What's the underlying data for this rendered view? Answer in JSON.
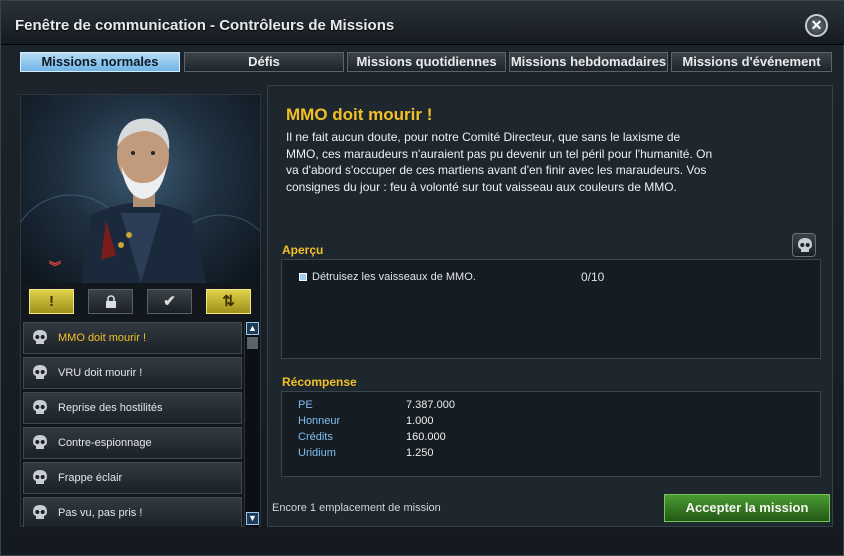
{
  "window": {
    "title": "Fenêtre de communication - Contrôleurs de Missions",
    "close_symbol": "✕"
  },
  "tabs": [
    {
      "label": "Missions normales",
      "active": true
    },
    {
      "label": "Défis",
      "active": false
    },
    {
      "label": "Missions quotidiennes",
      "active": false
    },
    {
      "label": "Missions hebdomadaires",
      "active": false
    },
    {
      "label": "Missions d'événement",
      "active": false
    }
  ],
  "filters": [
    {
      "icon": "exclamation-icon",
      "symbol": "!"
    },
    {
      "icon": "lock-icon",
      "symbol": ""
    },
    {
      "icon": "checkmark-icon",
      "symbol": "✔"
    },
    {
      "icon": "sort-arrows-icon",
      "symbol": "⇅"
    }
  ],
  "portrait_chevron": "︾",
  "missions": [
    {
      "label": "MMO doit mourir !",
      "selected": true
    },
    {
      "label": "VRU doit mourir !",
      "selected": false
    },
    {
      "label": "Reprise des hostilités",
      "selected": false
    },
    {
      "label": "Contre-espionnage",
      "selected": false
    },
    {
      "label": "Frappe éclair",
      "selected": false
    },
    {
      "label": "Pas vu, pas pris !",
      "selected": false
    }
  ],
  "scroll": {
    "up": "▲",
    "down": "▼"
  },
  "detail": {
    "title": "MMO doit mourir !",
    "description": "Il ne fait aucun doute, pour notre Comité Directeur, que sans le laxisme de MMO, ces maraudeurs n'auraient pas pu devenir un tel péril pour l'humanité. On va d'abord s'occuper de ces martiens avant d'en finir avec les maraudeurs. Vos consignes du jour : feu à volonté sur tout vaisseau aux couleurs de MMO.",
    "overview_label": "Aperçu",
    "objectives": [
      {
        "text": "Détruisez les vaisseaux de MMO.",
        "progress": "0/10"
      }
    ],
    "reward_label": "Récompense",
    "rewards": [
      {
        "name": "PE",
        "value": "7.387.000"
      },
      {
        "name": "Honneur",
        "value": "1.000"
      },
      {
        "name": "Crédits",
        "value": "160.000"
      },
      {
        "name": "Uridium",
        "value": "1.250"
      }
    ],
    "slots_text": "Encore 1 emplacement de mission",
    "accept_label": "Accepter la mission"
  },
  "colors": {
    "accent_yellow": "#f2c026",
    "tab_active": "#8ec8f0",
    "accept_green": "#3a8a26",
    "reward_blue": "#7fbdf2"
  }
}
